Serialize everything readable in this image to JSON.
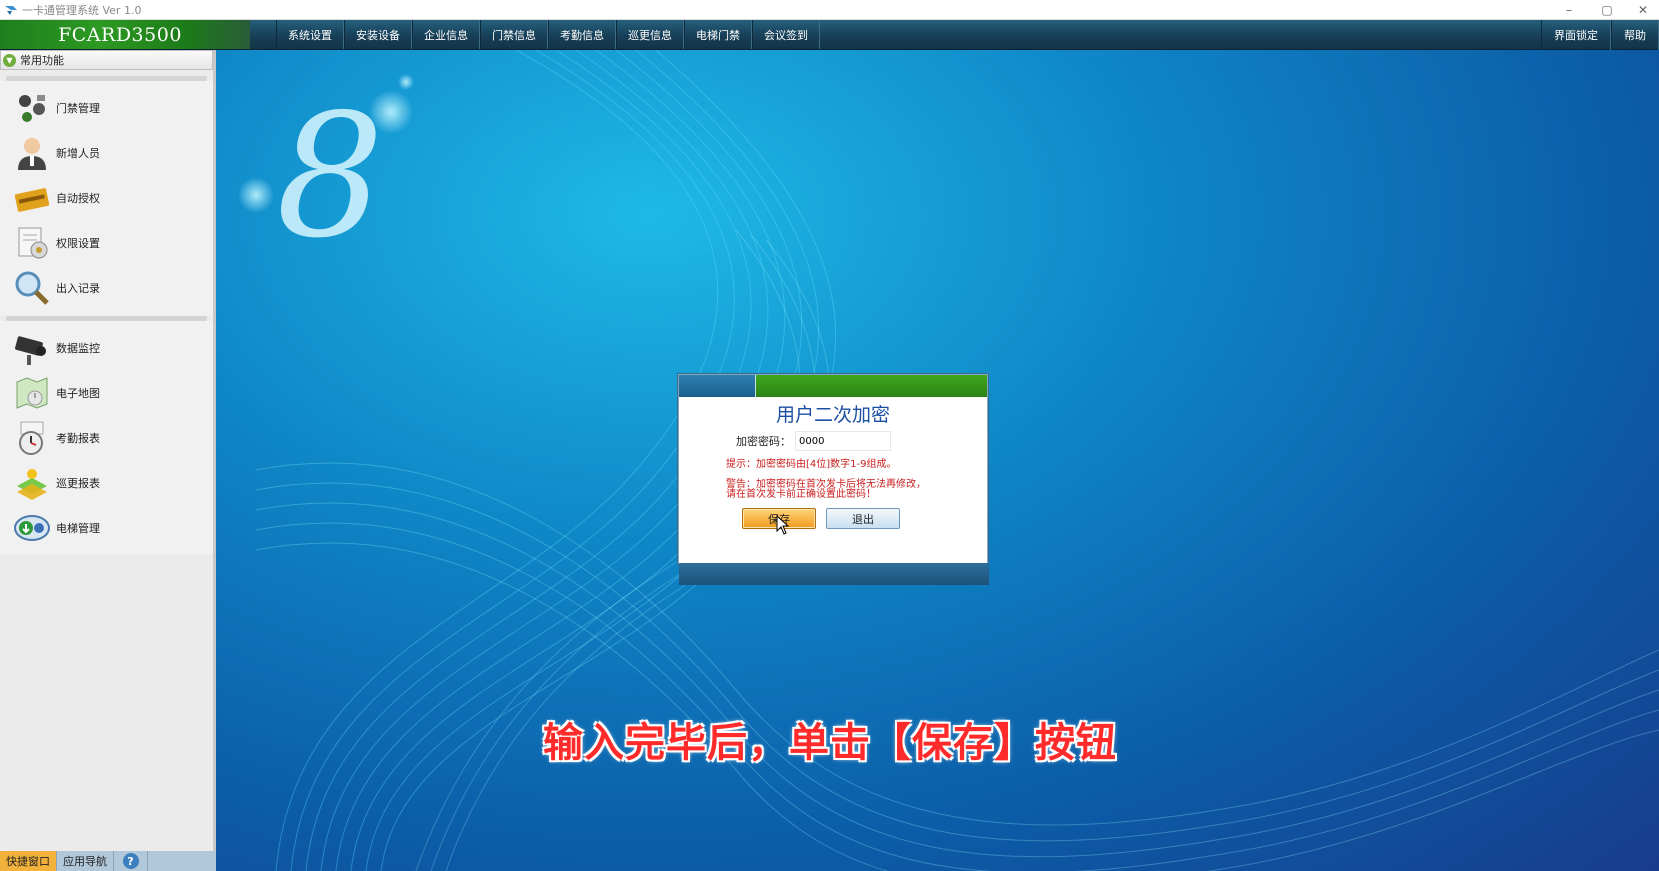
{
  "window": {
    "title": "一卡通管理系统  Ver 1.0",
    "controls": [
      "–",
      "▢",
      "✕"
    ]
  },
  "menubar": {
    "brand": "FCARD3500",
    "items": [
      "系统设置",
      "安装设备",
      "企业信息",
      "门禁信息",
      "考勤信息",
      "巡更信息",
      "电梯门禁",
      "会议签到"
    ],
    "right_items": [
      "界面锁定",
      "帮助"
    ]
  },
  "sidebar": {
    "header": "常用功能",
    "group1": [
      {
        "label": "门禁管理",
        "icon": "door-access-icon"
      },
      {
        "label": "新增人员",
        "icon": "person-icon"
      },
      {
        "label": "自动授权",
        "icon": "card-icon"
      },
      {
        "label": "权限设置",
        "icon": "permission-icon"
      },
      {
        "label": "出入记录",
        "icon": "magnifier-icon"
      }
    ],
    "group2": [
      {
        "label": "数据监控",
        "icon": "camera-icon"
      },
      {
        "label": "电子地图",
        "icon": "map-icon"
      },
      {
        "label": "考勤报表",
        "icon": "clock-icon"
      },
      {
        "label": "巡更报表",
        "icon": "patrol-icon"
      },
      {
        "label": "电梯管理",
        "icon": "elevator-icon"
      }
    ]
  },
  "bottom_tabs": {
    "quick": "快捷窗口",
    "nav": "应用导航",
    "help": "?"
  },
  "dialog": {
    "title": "用户二次加密",
    "field_label": "加密密码：",
    "field_value": "0000",
    "hint": "提示：加密密码由[4位]数字1-9组成。",
    "warning_line1": "警告：加密密码在首次发卡后将无法再修改，",
    "warning_line2": "请在首次发卡前正确设置此密码！",
    "save_label": "保存",
    "exit_label": "退出"
  },
  "caption": "输入完毕后，单击【保存】按钮",
  "colors": {
    "brand_green": "#2c9a22",
    "menubar_bg": "#1b4a63",
    "caption_red": "#ff2a2a",
    "hint_red": "#c81e1e",
    "dialog_title": "#1b4fa3"
  }
}
